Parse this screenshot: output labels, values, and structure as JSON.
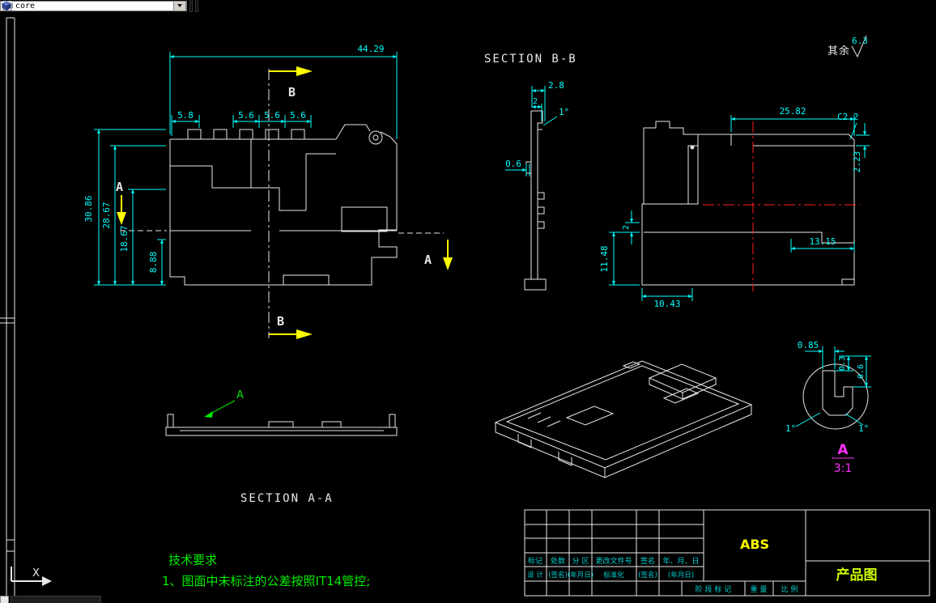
{
  "toolbar": {
    "layer_value": "core"
  },
  "drawing": {
    "section_labels": {
      "bb": "SECTION B-B",
      "aa": "SECTION A-A"
    },
    "roughness": {
      "prefix": "其余",
      "value": "6.3"
    },
    "markers": {
      "a": "A",
      "b": "B"
    },
    "plan": {
      "total_width": "44.29",
      "pitch1": "5.8",
      "pitch2": "5.6",
      "pitch3": "5.6",
      "pitch4": "5.6",
      "height1": "30.86",
      "height2": "28.67",
      "height3": "18.67",
      "height4": "8.88"
    },
    "section_bb": {
      "w_top": "2.8",
      "w_top2": "2",
      "angle": "1°",
      "thickness": "0.6"
    },
    "side": {
      "width_top": "25.82",
      "chamfer": "C2.2",
      "depth": "2.23",
      "width_inner": "13.15",
      "width_bottom": "10.43",
      "height_left": "11.48",
      "step": "2"
    },
    "detail": {
      "width": "0.85",
      "h1": "0.3",
      "h2": "0.6",
      "angle1": "1°",
      "angle2": "1°",
      "label": "A",
      "scale": "3:1"
    },
    "tech_requirements": {
      "title": "技术要求",
      "item1": "1、图面中未标注的公差按照IT14管控;"
    },
    "ucs": {
      "x": "X"
    }
  },
  "title_block": {
    "material": "ABS",
    "product_name": "产品图",
    "revision_headers": [
      "标记",
      "处数",
      "分 区",
      "更改文件号",
      "签名",
      "年、月、日"
    ],
    "sign_row": [
      "设 计",
      "(签名)",
      "(年月日)",
      "标准化",
      "(签名)",
      "(年月日)"
    ],
    "stage_labels": [
      "阶 段 标 记",
      "重 量",
      "比 例"
    ]
  },
  "colors": {
    "background": "#000000",
    "outline": "#e8e8e8",
    "dimension": "#00ffff",
    "section_arrow": "#ffff00",
    "centerline": "#ff2020",
    "tech_text": "#00ee00",
    "detail_label": "#ff30ff",
    "material_text": "#ffff00",
    "product_text": "#ccff00",
    "title_block_text": "#00d0d0"
  }
}
